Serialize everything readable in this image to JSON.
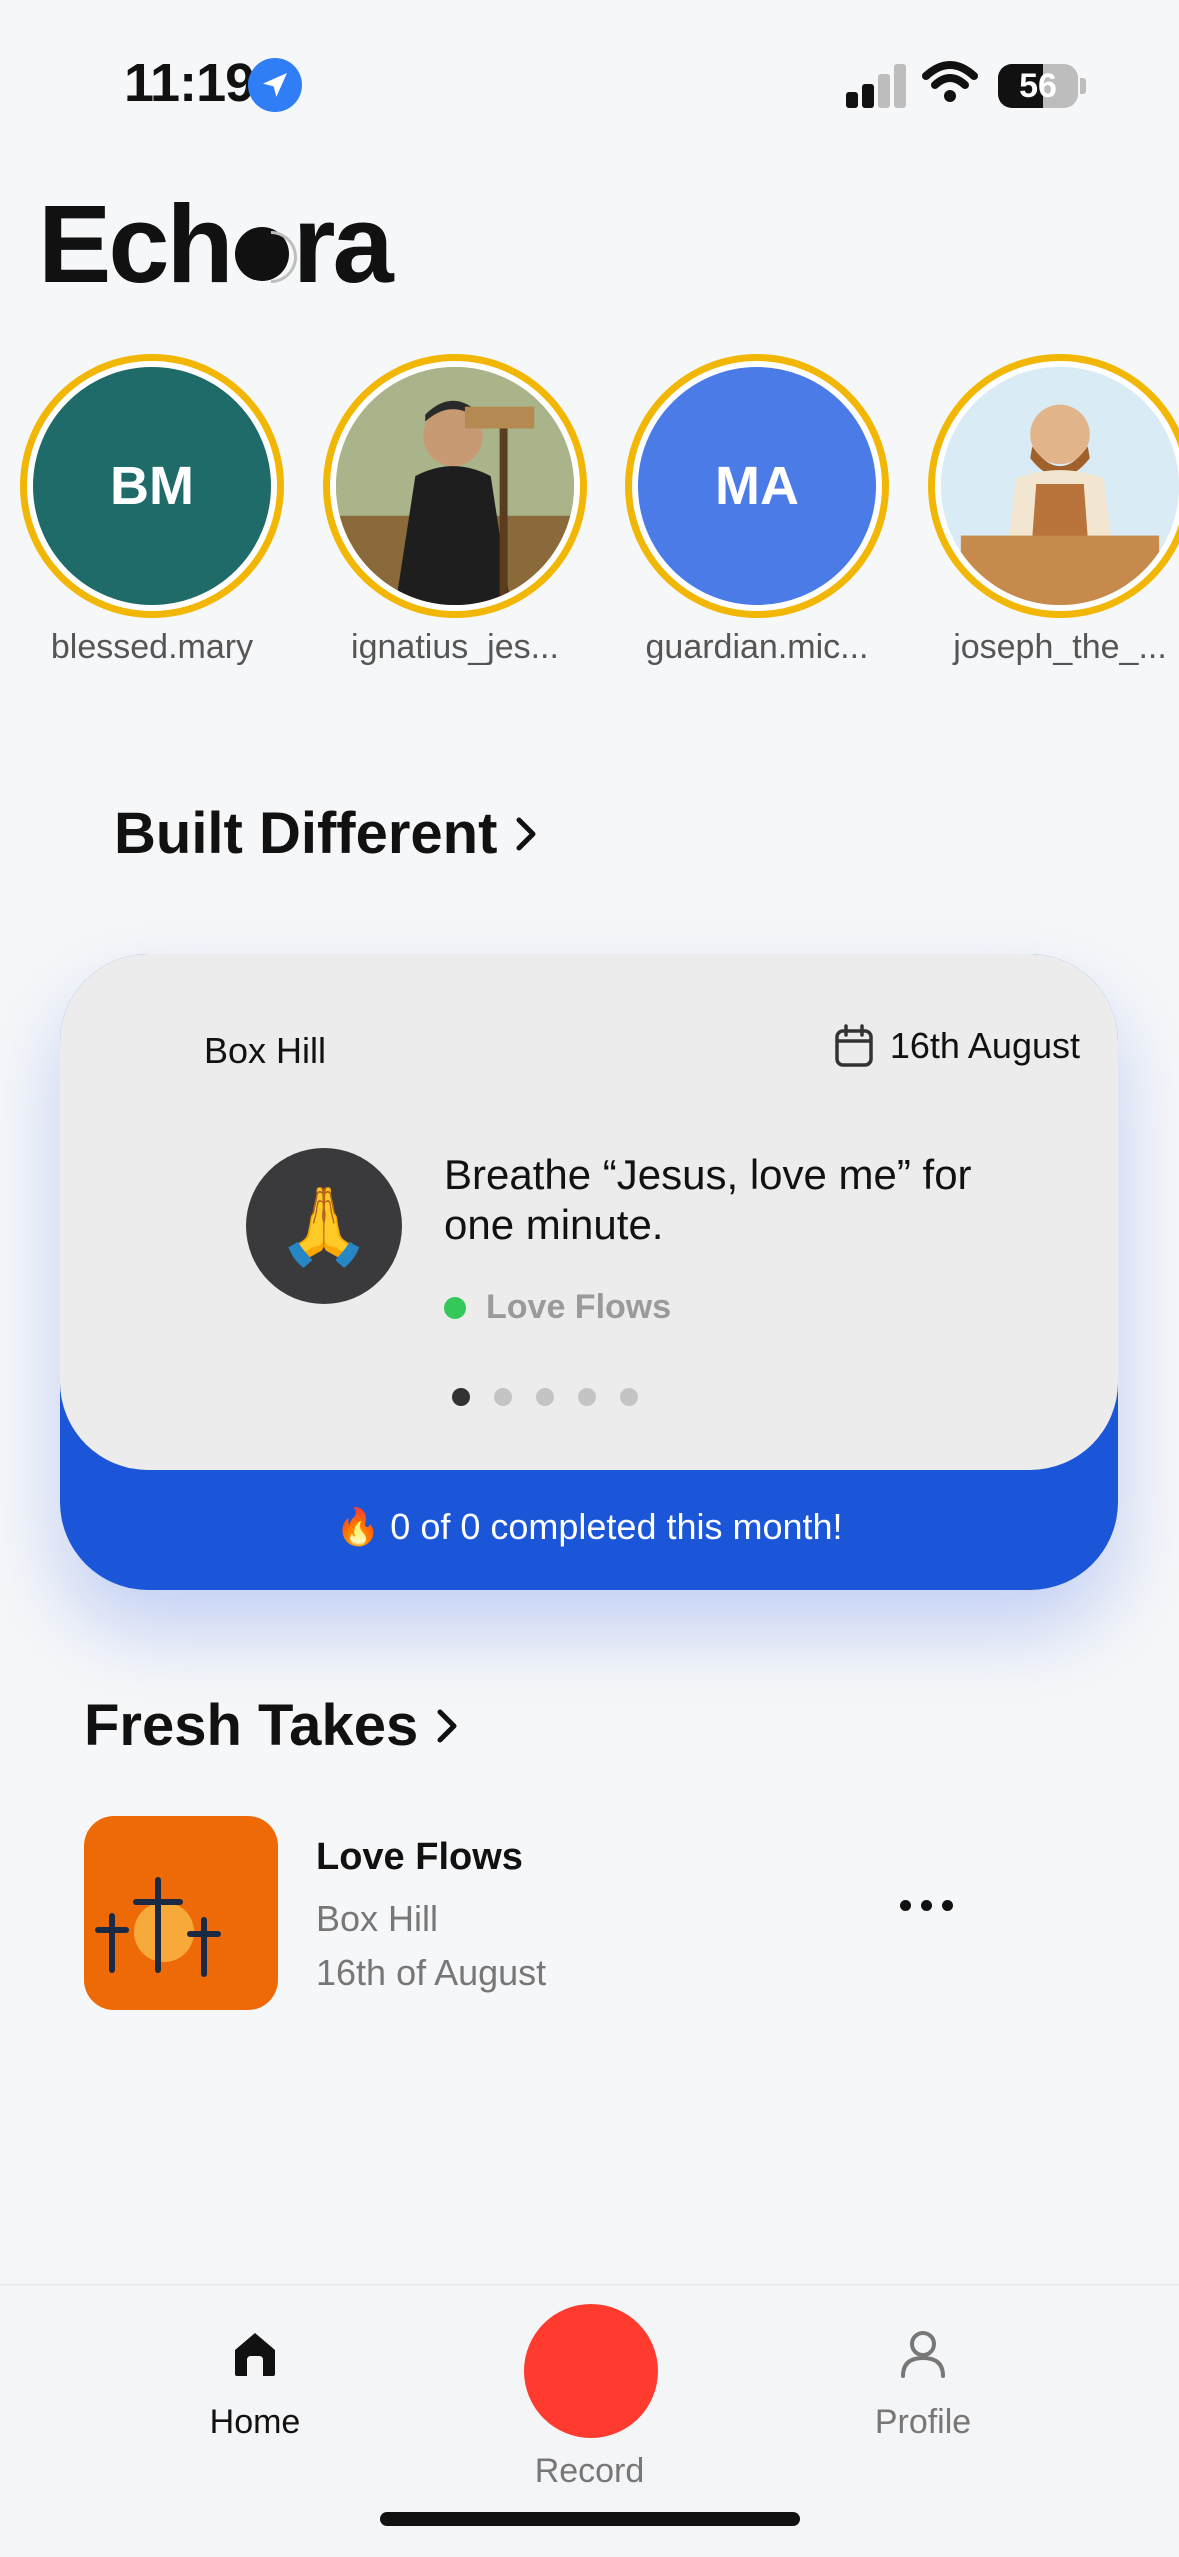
{
  "status_bar": {
    "time": "11:19",
    "battery": "56",
    "battery_level": 0.56
  },
  "app": {
    "name_before": "Ech",
    "name_after": "ra"
  },
  "stories": [
    {
      "name": "blessed.mary",
      "initials": "BM",
      "color": "#1f6b6a"
    },
    {
      "name": "ignatius_jes...",
      "initials": "",
      "color": "#6b5a3a"
    },
    {
      "name": "guardian.mic...",
      "initials": "MA",
      "color": "#4a7be6"
    },
    {
      "name": "joseph_the_...",
      "initials": "",
      "color": "#c89a64"
    }
  ],
  "built_different": {
    "title": "Built Different",
    "card": {
      "location": "Box Hill",
      "date": "16th August",
      "prompt": "Breathe “Jesus, love me” for one minute.",
      "tag": "Love Flows",
      "page_count": 5,
      "active_page": 1,
      "progress": "0 of 0 completed this month!"
    }
  },
  "fresh_takes": {
    "title": "Fresh Takes",
    "items": [
      {
        "title": "Love Flows",
        "location": "Box Hill",
        "date": "16th of August"
      }
    ]
  },
  "tabbar": {
    "home": "Home",
    "record": "Record",
    "profile": "Profile"
  },
  "colors": {
    "accent": "#1b56d9",
    "record": "#ff3b30",
    "ring": "#f2b705",
    "tag_dot": "#34c759"
  }
}
